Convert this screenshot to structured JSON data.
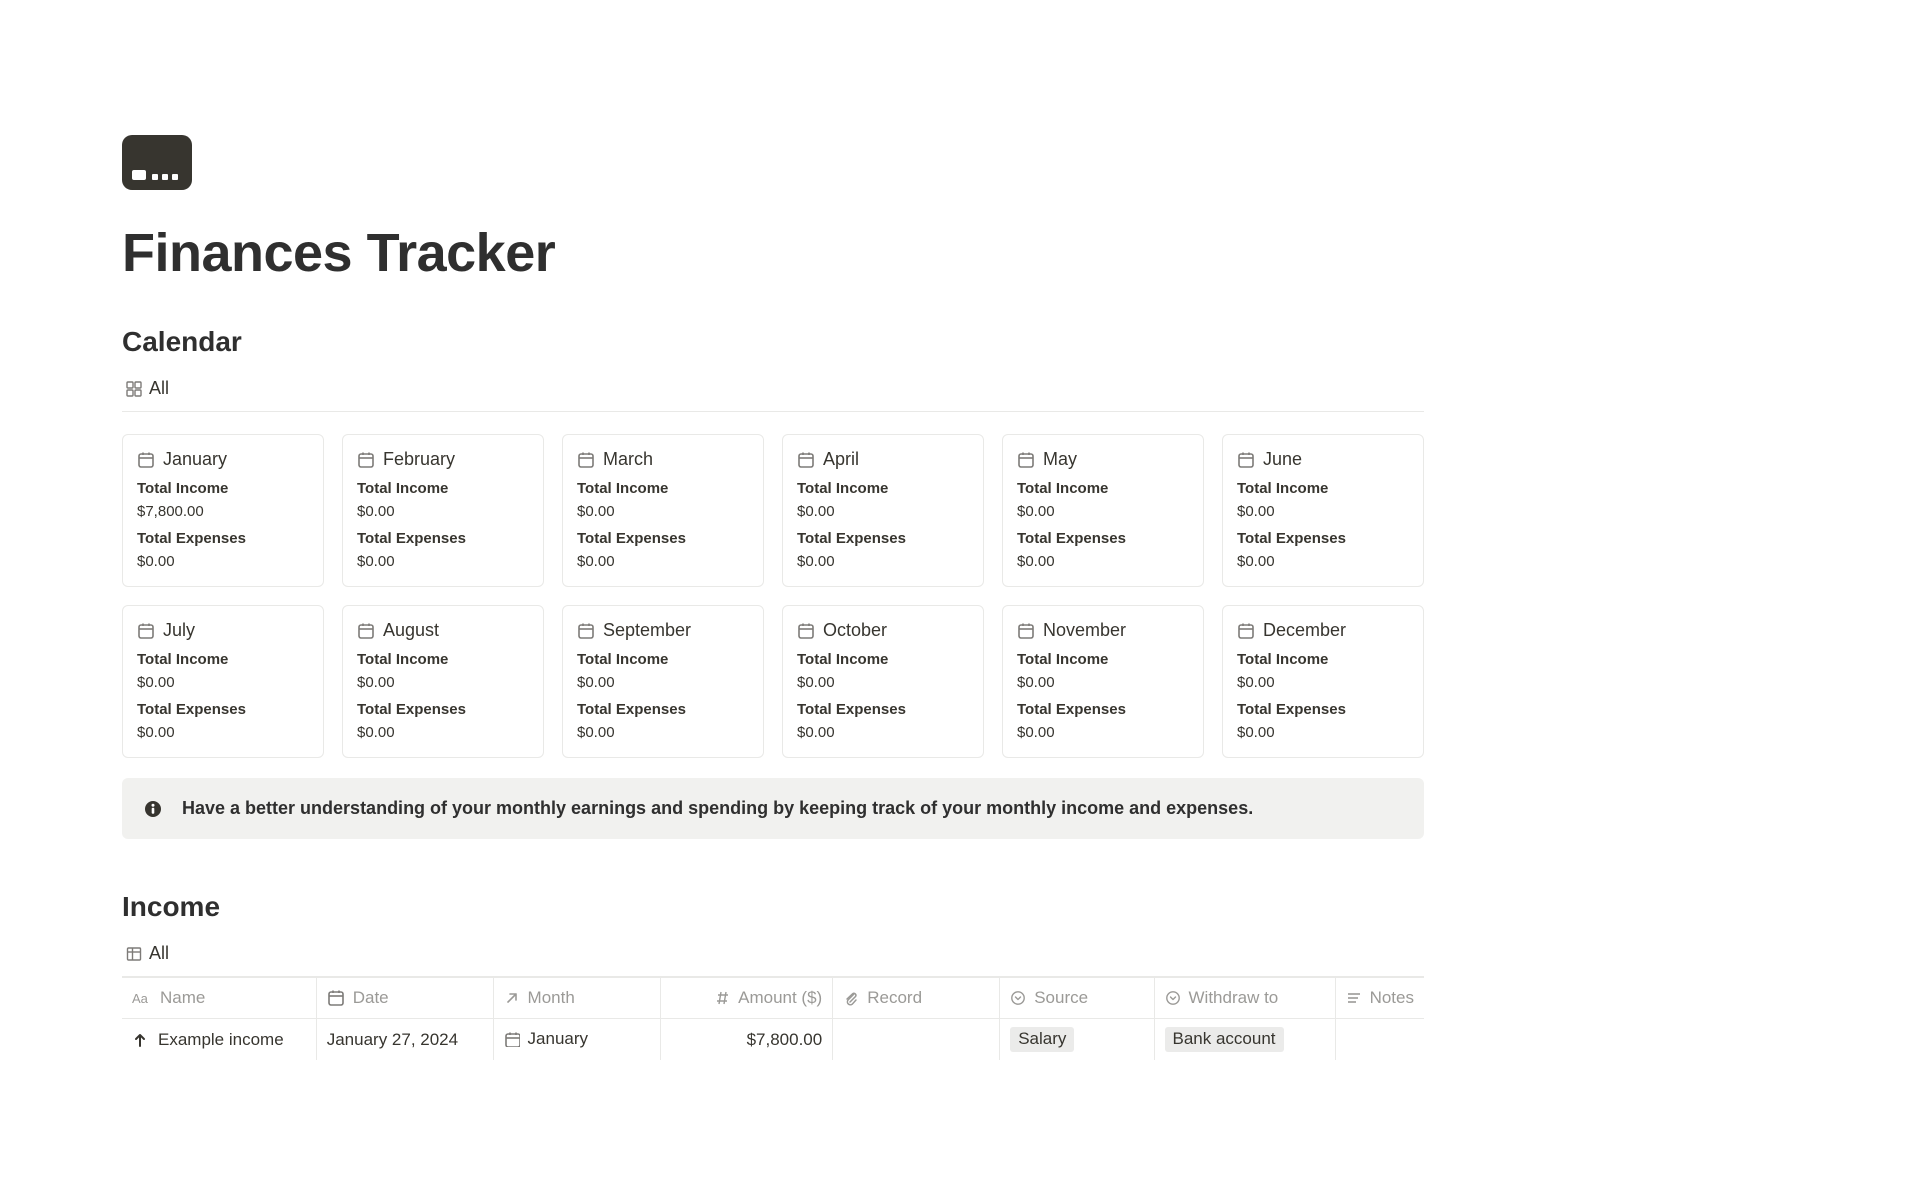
{
  "page": {
    "title": "Finances Tracker"
  },
  "calendar": {
    "heading": "Calendar",
    "view_label": "All",
    "labels": {
      "income": "Total Income",
      "expenses": "Total Expenses"
    },
    "months": [
      {
        "name": "January",
        "income": "$7,800.00",
        "expenses": "$0.00"
      },
      {
        "name": "February",
        "income": "$0.00",
        "expenses": "$0.00"
      },
      {
        "name": "March",
        "income": "$0.00",
        "expenses": "$0.00"
      },
      {
        "name": "April",
        "income": "$0.00",
        "expenses": "$0.00"
      },
      {
        "name": "May",
        "income": "$0.00",
        "expenses": "$0.00"
      },
      {
        "name": "June",
        "income": "$0.00",
        "expenses": "$0.00"
      },
      {
        "name": "July",
        "income": "$0.00",
        "expenses": "$0.00"
      },
      {
        "name": "August",
        "income": "$0.00",
        "expenses": "$0.00"
      },
      {
        "name": "September",
        "income": "$0.00",
        "expenses": "$0.00"
      },
      {
        "name": "October",
        "income": "$0.00",
        "expenses": "$0.00"
      },
      {
        "name": "November",
        "income": "$0.00",
        "expenses": "$0.00"
      },
      {
        "name": "December",
        "income": "$0.00",
        "expenses": "$0.00"
      }
    ]
  },
  "callout": {
    "text": "Have a better understanding of your monthly earnings and spending by keeping track of your monthly income and expenses."
  },
  "income": {
    "heading": "Income",
    "view_label": "All",
    "columns": {
      "name": "Name",
      "date": "Date",
      "month": "Month",
      "amount": "Amount ($)",
      "record": "Record",
      "source": "Source",
      "withdraw": "Withdraw to",
      "notes": "Notes"
    },
    "rows": [
      {
        "name": "Example income",
        "date": "January 27, 2024",
        "month": "January",
        "amount": "$7,800.00",
        "record": "",
        "source": "Salary",
        "withdraw": "Bank account",
        "notes": ""
      }
    ]
  }
}
